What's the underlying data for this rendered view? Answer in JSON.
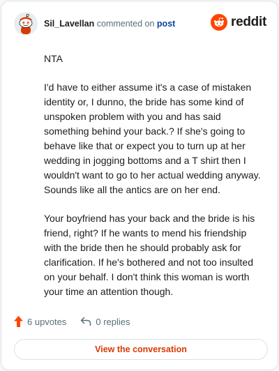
{
  "header": {
    "username": "Sil_Lavellan",
    "action_text": "commented on",
    "post_link": "post",
    "logo_text": "reddit"
  },
  "comment": {
    "paragraphs": [
      "NTA",
      "I'd have to either assume it's a case of mistaken identity or, I dunno, the bride has some kind of unspoken problem with you and has said something behind your back.? If she's going to behave like that or expect you to turn up at her wedding in jogging bottoms and a T shirt then I wouldn't want to go to her actual wedding anyway. Sounds like all the antics are on her end.",
      "Your boyfriend has your back and the bride is his friend, right? If he wants to mend his friendship with the bride then he should probably ask for clarification. If he's bothered and not too insulted on your behalf. I don't think this woman is worth your time an attention though."
    ]
  },
  "footer": {
    "upvotes": "6 upvotes",
    "replies": "0 replies"
  },
  "cta": {
    "label": "View the conversation"
  },
  "colors": {
    "brand_orange": "#ff4500",
    "link_blue": "#0a449b",
    "cta_text": "#d93a00",
    "muted": "#576f76"
  }
}
